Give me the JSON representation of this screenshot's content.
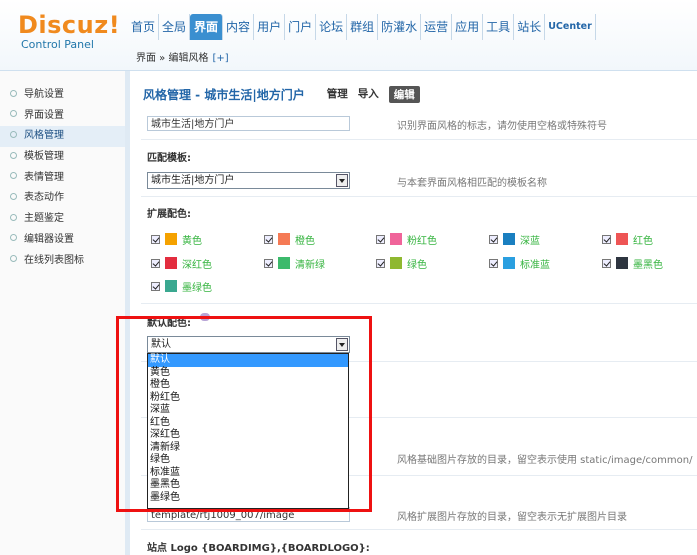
{
  "header": {
    "brand": "Discuz!",
    "subtitle": "Control Panel",
    "nav": [
      "首页",
      "全局",
      "界面",
      "内容",
      "用户",
      "门户",
      "论坛",
      "群组",
      "防灌水",
      "运营",
      "应用",
      "工具",
      "站长",
      "UCenter"
    ],
    "active_nav": "界面",
    "breadcrumb": "界面 » 编辑风格",
    "breadcrumb_plus": "[+]"
  },
  "sidebar": {
    "items": [
      "导航设置",
      "界面设置",
      "风格管理",
      "模板管理",
      "表情管理",
      "表态动作",
      "主题鉴定",
      "编辑器设置",
      "在线列表图标"
    ],
    "active": "风格管理"
  },
  "main": {
    "page_title": "风格管理 - 城市生活|地方门户",
    "tabs": [
      "管理",
      "导入",
      "编辑"
    ],
    "active_tab": "编辑",
    "style_name_value": "城市生活|地方门户",
    "style_name_hint": "识别界面风格的标志，请勿使用空格或特殊符号",
    "template_label": "匹配模板:",
    "template_value": "城市生活|地方门户",
    "template_hint": "与本套界面风格相匹配的模板名称",
    "ext_colors_label": "扩展配色:",
    "colors": [
      {
        "name": "黄色",
        "hex": "#f5a200"
      },
      {
        "name": "橙色",
        "hex": "#f57a55"
      },
      {
        "name": "粉红色",
        "hex": "#f0649a"
      },
      {
        "name": "深蓝",
        "hex": "#1a7fc0"
      },
      {
        "name": "红色",
        "hex": "#ee5555"
      },
      {
        "name": "深红色",
        "hex": "#e32d3f"
      },
      {
        "name": "清新绿",
        "hex": "#3cba6c"
      },
      {
        "name": "绿色",
        "hex": "#8fb830"
      },
      {
        "name": "标准蓝",
        "hex": "#2a9fe0"
      },
      {
        "name": "墨黑色",
        "hex": "#2e3540"
      },
      {
        "name": "墨绿色",
        "hex": "#3aa890"
      }
    ],
    "default_color_label": "默认配色:",
    "default_color_value": "默认",
    "dropdown_options": [
      "默认",
      "黄色",
      "橙色",
      "粉红色",
      "深蓝",
      "红色",
      "深红色",
      "清新绿",
      "绿色",
      "标准蓝",
      "墨黑色",
      "墨绿色"
    ],
    "image_dir_hint": "风格基础图片存放的目录，留空表示使用 static/image/common/ 目录",
    "ext_image_dir_value": "template/rtj1009_007/image",
    "ext_image_dir_hint": "风格扩展图片存放的目录，留空表示无扩展图片目录",
    "logo_label": "站点 Logo {BOARDIMG},{BOARDLOGO}:"
  },
  "colors": {
    "accent": "#2366a8",
    "highlight": "#ee1111",
    "selection": "#3399ff"
  }
}
